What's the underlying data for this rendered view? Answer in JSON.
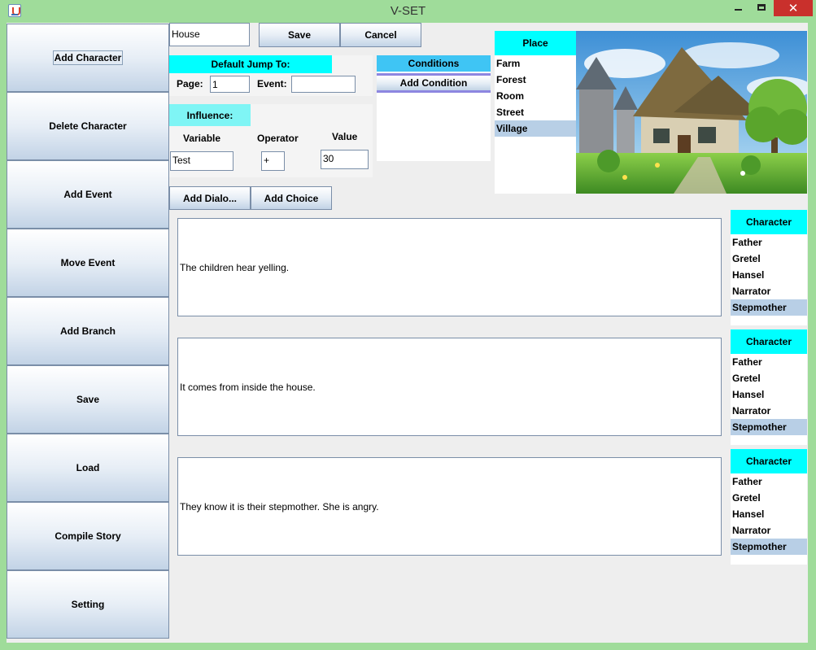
{
  "window": {
    "title": "V-SET"
  },
  "sidebar": {
    "items": [
      {
        "label": "Add Character"
      },
      {
        "label": "Delete Character"
      },
      {
        "label": "Add Event"
      },
      {
        "label": "Move Event"
      },
      {
        "label": "Add Branch"
      },
      {
        "label": "Save"
      },
      {
        "label": "Load"
      },
      {
        "label": "Compile Story"
      },
      {
        "label": "Setting"
      }
    ]
  },
  "toolbar": {
    "name_value": "House",
    "save_label": "Save",
    "cancel_label": "Cancel"
  },
  "jump": {
    "header": "Default Jump To:",
    "page_label": "Page:",
    "page_value": "1",
    "event_label": "Event:",
    "event_value": ""
  },
  "influence": {
    "header": "Influence:",
    "variable_label": "Variable",
    "operator_label": "Operator",
    "value_label": "Value",
    "variable_value": "Test",
    "operator_value": "+",
    "value_value": "30"
  },
  "conditions": {
    "header": "Conditions",
    "add_label": "Add Condition"
  },
  "place": {
    "header": "Place",
    "items": [
      "Farm",
      "Forest",
      "Room",
      "Street",
      "Village"
    ],
    "selected": "Village"
  },
  "actions": {
    "add_dialog_label": "Add Dialo...",
    "add_choice_label": "Add Choice"
  },
  "dialogs": [
    {
      "text": "The children hear yelling.",
      "character_header": "Character",
      "characters": [
        "Father",
        "Gretel",
        "Hansel",
        "Narrator",
        "Stepmother"
      ],
      "selected": "Stepmother"
    },
    {
      "text": "It comes from inside the house.",
      "character_header": "Character",
      "characters": [
        "Father",
        "Gretel",
        "Hansel",
        "Narrator",
        "Stepmother"
      ],
      "selected": "Stepmother"
    },
    {
      "text": "They know it is their stepmother. She is angry.",
      "character_header": "Character",
      "characters": [
        "Father",
        "Gretel",
        "Hansel",
        "Narrator",
        "Stepmother"
      ],
      "selected": "Stepmother"
    }
  ],
  "colors": {
    "accent": "#00ffff",
    "selection": "#b8cfe6",
    "window_frame": "#9fdc9a",
    "close": "#c9302c"
  }
}
